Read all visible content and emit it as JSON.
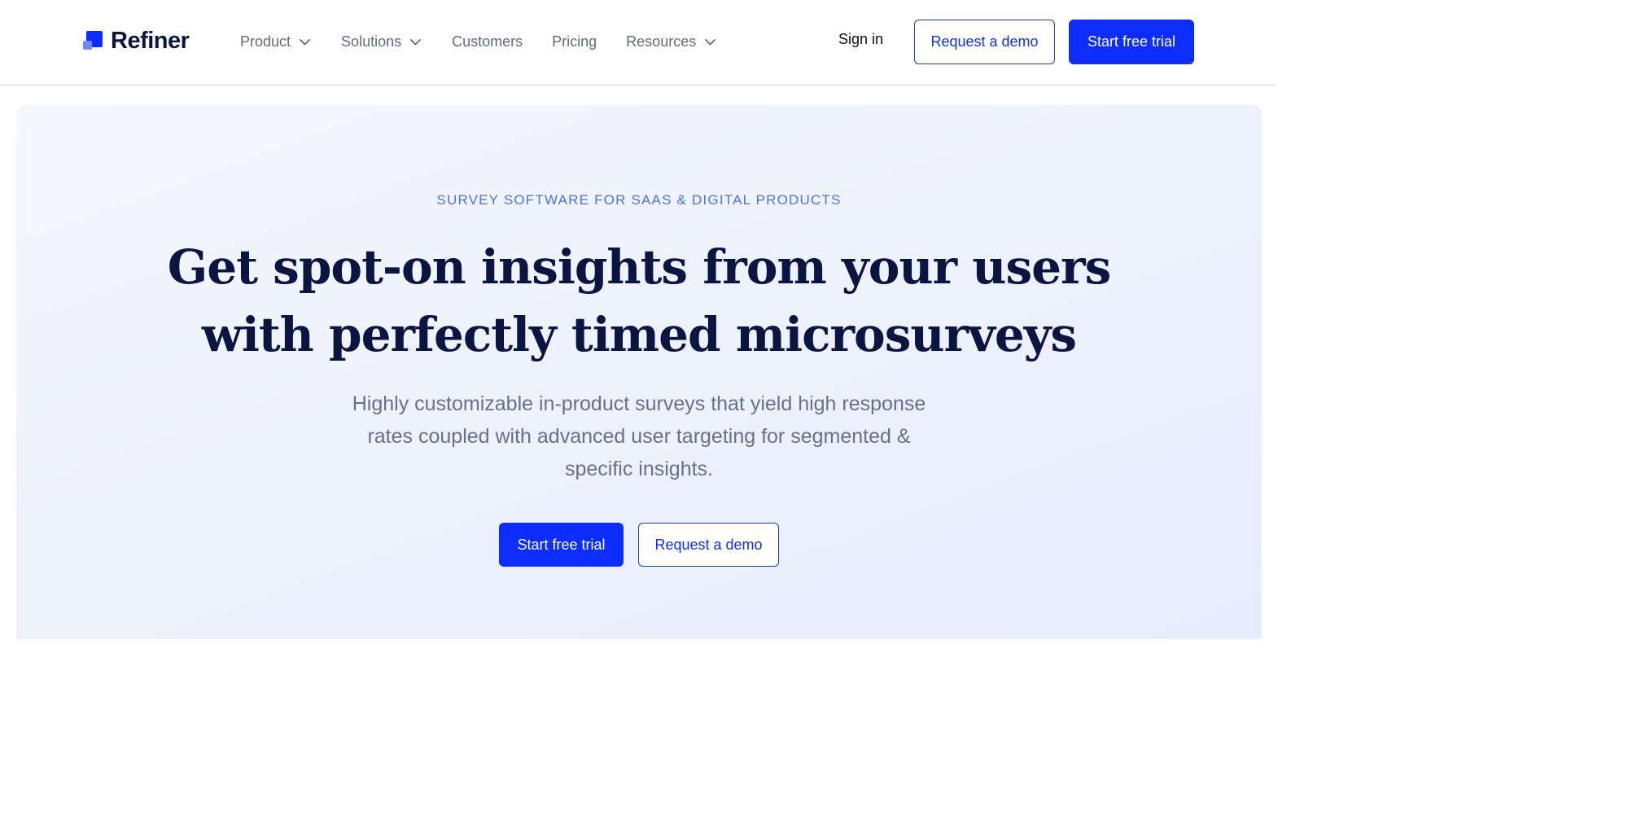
{
  "brand": {
    "name": "Refiner",
    "primary_color": "#0d2dff",
    "logo_icon": "refiner-logo-icon"
  },
  "nav": {
    "items": [
      {
        "label": "Product",
        "has_dropdown": true
      },
      {
        "label": "Solutions",
        "has_dropdown": true
      },
      {
        "label": "Customers",
        "has_dropdown": false
      },
      {
        "label": "Pricing",
        "has_dropdown": false
      },
      {
        "label": "Resources",
        "has_dropdown": true
      }
    ],
    "sign_in": "Sign in",
    "request_demo": "Request a demo",
    "start_trial": "Start free trial"
  },
  "hero": {
    "eyebrow": "SURVEY SOFTWARE FOR SAAS & DIGITAL PRODUCTS",
    "headline_line1": "Get spot-on insights from your users",
    "headline_line2": "with perfectly timed microsurveys",
    "subtext": "Highly customizable in-product surveys that yield high response rates coupled with advanced user targeting for segmented & specific insights.",
    "cta_primary": "Start free trial",
    "cta_secondary": "Request a demo",
    "headline_color": "#0b1541",
    "eyebrow_color": "#4c74e0"
  }
}
